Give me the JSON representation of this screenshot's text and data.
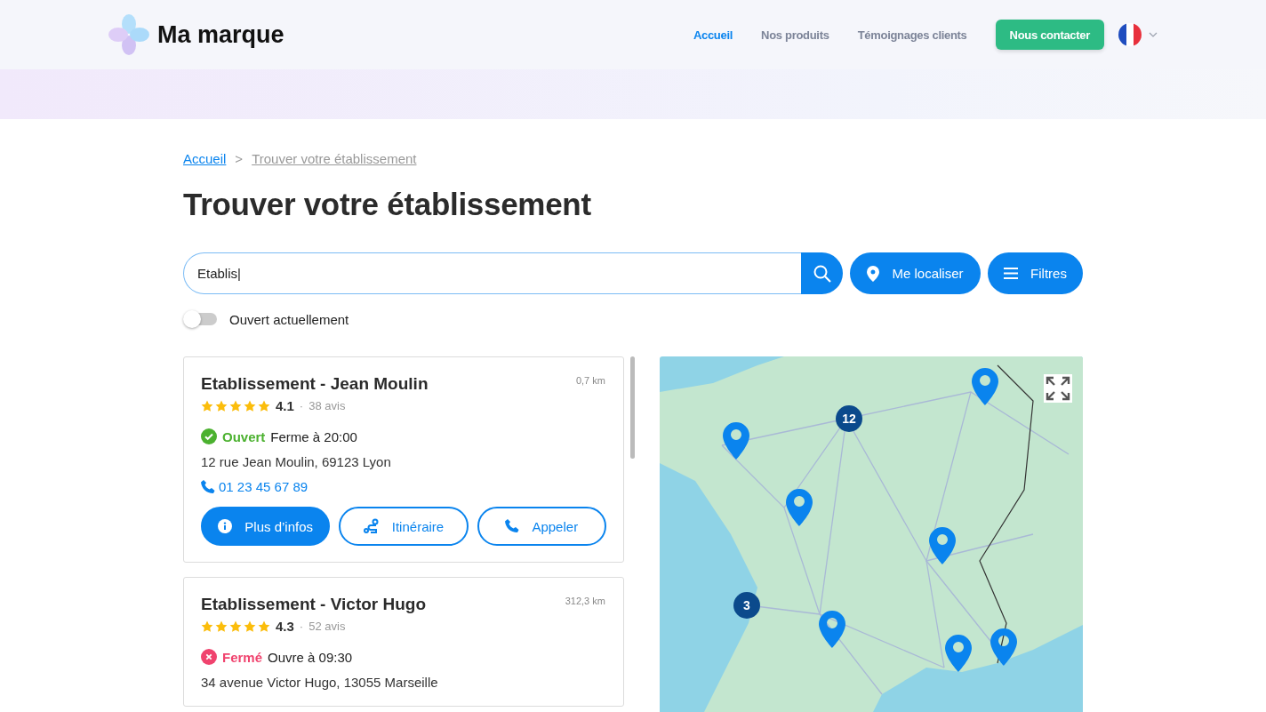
{
  "header": {
    "brand": "Ma marque",
    "nav": [
      {
        "label": "Accueil",
        "selected": true
      },
      {
        "label": "Nos produits",
        "selected": false
      },
      {
        "label": "Témoignages clients",
        "selected": false
      }
    ],
    "contact_button": "Nous contacter"
  },
  "breadcrumb": {
    "items": [
      "Accueil",
      "Trouver votre établissement"
    ],
    "separator": ">"
  },
  "title": "Trouver votre établissement",
  "search": {
    "value": "Etablis|"
  },
  "actions": [
    {
      "kind": "locate",
      "label": "Me localiser"
    },
    {
      "kind": "filters",
      "label": "Filtres"
    }
  ],
  "filter_toggle": {
    "label": "Ouvert actuellement",
    "on": false
  },
  "results": [
    {
      "name": "Etablissement - Jean Moulin",
      "distance": "0,7 km",
      "stars": 5,
      "rating": "4.1",
      "separator": "·",
      "reviews": "38 avis",
      "open": true,
      "status": "Ouvert",
      "hours": "Ferme à 20:00",
      "address": "12 rue Jean Moulin, 69123 Lyon",
      "phone": "01 23 45 67 89",
      "buttons": [
        {
          "kind": "info",
          "label": "Plus d’infos"
        },
        {
          "kind": "route",
          "label": "Itinéraire"
        },
        {
          "kind": "call",
          "label": "Appeler"
        }
      ]
    },
    {
      "name": "Etablissement - Victor Hugo",
      "distance": "312,3 km",
      "stars": 5,
      "rating": "4.3",
      "separator": "·",
      "reviews": "52 avis",
      "open": false,
      "status": "Fermé",
      "hours": "Ouvre à 09:30",
      "address": "34 avenue Victor Hugo, 13055 Marseille"
    }
  ],
  "map": {
    "clusters": [
      "12",
      "3"
    ]
  }
}
